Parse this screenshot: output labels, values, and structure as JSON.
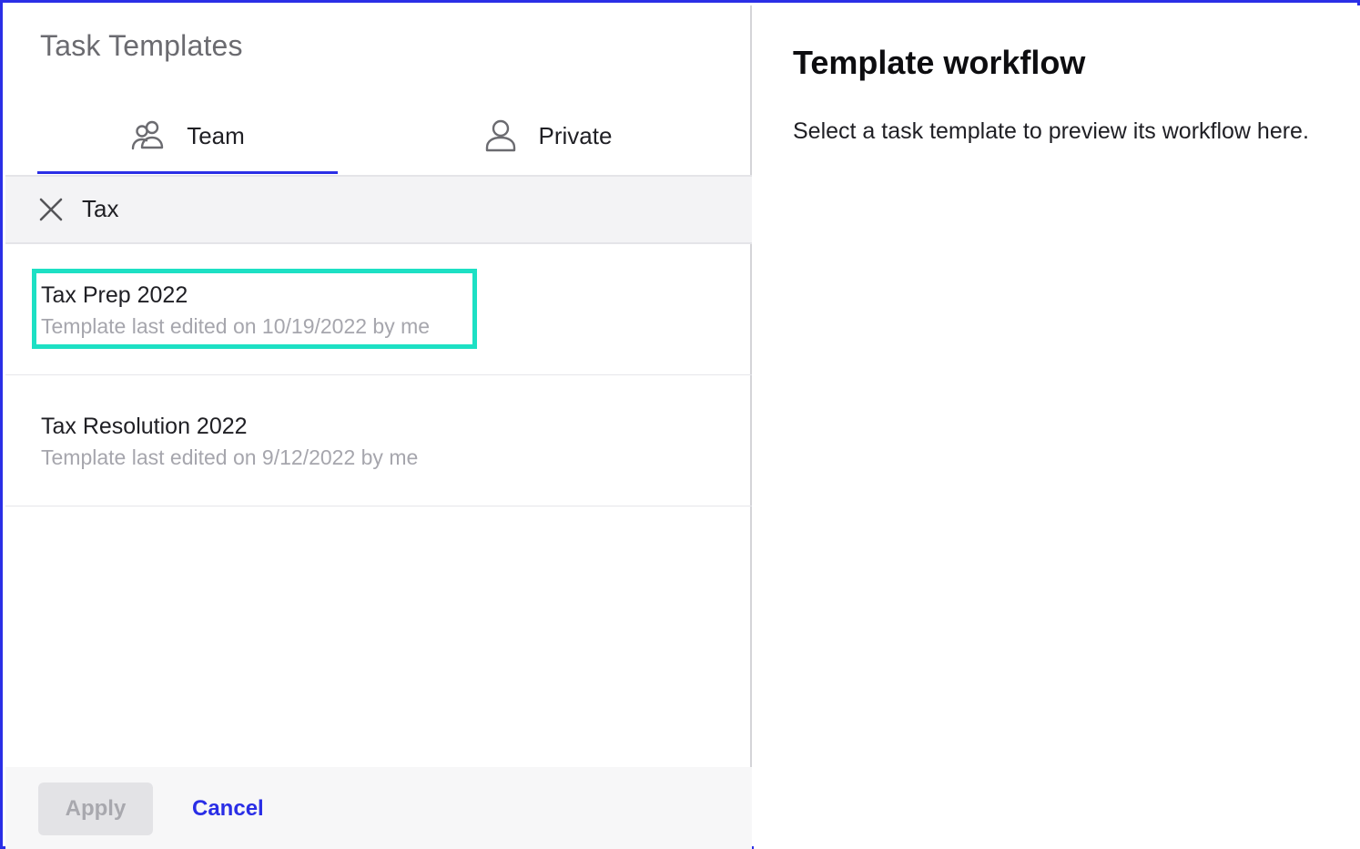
{
  "panel_title": "Task Templates",
  "tabs": [
    {
      "label": "Team",
      "icon": "team-icon",
      "active": true
    },
    {
      "label": "Private",
      "icon": "user-icon",
      "active": false
    }
  ],
  "filter": {
    "value": "Tax",
    "clear_icon": "close-icon"
  },
  "templates": [
    {
      "title": "Tax Prep 2022",
      "subtitle": "Template last edited on 10/19/2022 by me",
      "highlighted": true
    },
    {
      "title": "Tax Resolution 2022",
      "subtitle": "Template last edited on 9/12/2022 by me",
      "highlighted": false
    }
  ],
  "footer": {
    "apply_label": "Apply",
    "cancel_label": "Cancel"
  },
  "preview": {
    "title": "Template workflow",
    "description": "Select a task template to preview its workflow here."
  },
  "colors": {
    "accent": "#2a2ee6",
    "highlight": "#1de0c4",
    "frame": "#2a2ee6"
  }
}
